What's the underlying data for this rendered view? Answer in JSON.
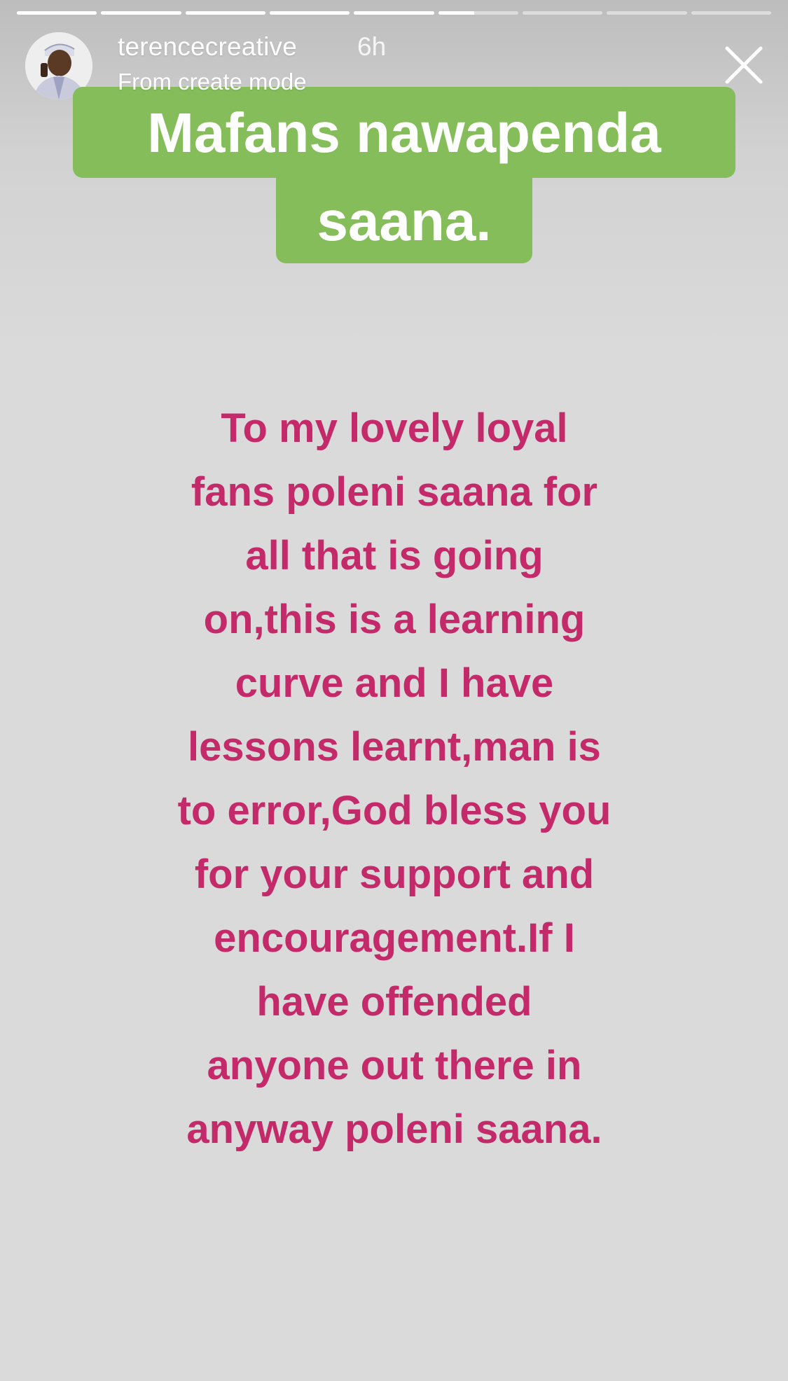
{
  "story": {
    "segments": [
      {
        "progress": 1.0
      },
      {
        "progress": 1.0
      },
      {
        "progress": 1.0
      },
      {
        "progress": 1.0
      },
      {
        "progress": 1.0
      },
      {
        "progress": 0.45
      },
      {
        "progress": 0.0
      },
      {
        "progress": 0.0
      },
      {
        "progress": 0.0
      }
    ]
  },
  "header": {
    "username": "terencecreative",
    "time": "6h",
    "subtitle": "From create mode",
    "avatar_icon": "profile-photo",
    "close_icon": "close-icon"
  },
  "title": {
    "line1": "Mafans nawapenda",
    "line2": "saana.",
    "background_color": "#84bd5a"
  },
  "message": {
    "lines": [
      "To my lovely loyal",
      "fans poleni saana for",
      "all that is going",
      "on,this is a learning",
      "curve and I have",
      "lessons learnt,man is",
      "to error,God bless you",
      "for your support and",
      "encouragement.If I",
      "have offended",
      "anyone out there in",
      "anyway poleni saana."
    ],
    "color": "#c42a6a"
  }
}
